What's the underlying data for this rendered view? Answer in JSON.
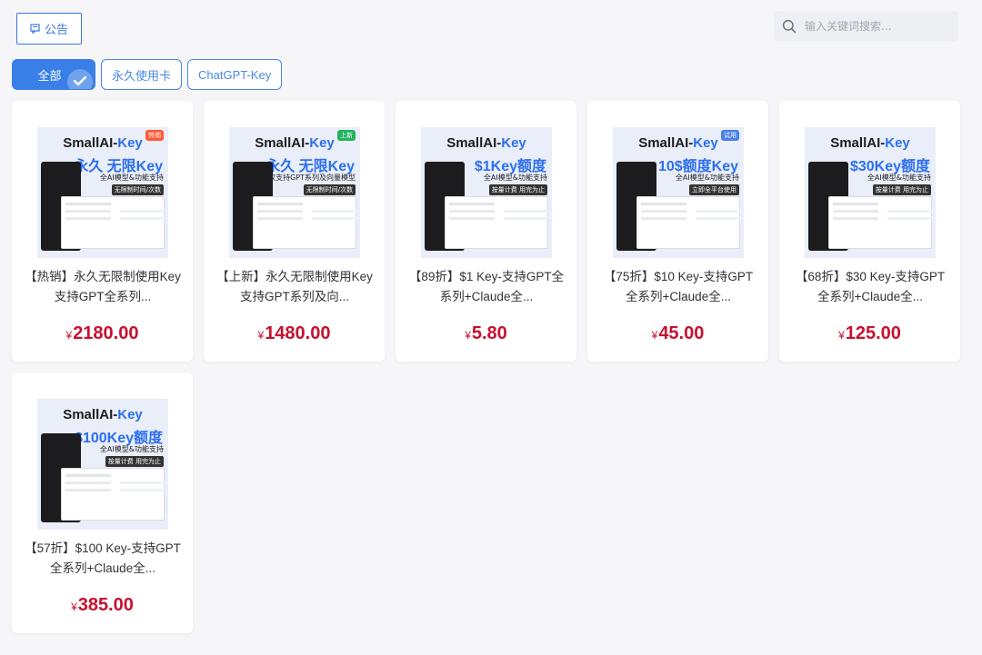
{
  "header": {
    "notice_label": "公告",
    "search_placeholder": "输入关键词搜索..."
  },
  "tabs": [
    {
      "label": "全部",
      "active": true
    },
    {
      "label": "永久使用卡",
      "active": false
    },
    {
      "label": "ChatGPT-Key",
      "active": false
    }
  ],
  "colors": {
    "accent": "#3a7fe8",
    "price": "#c8102e",
    "brand_blue": "#2d6ff0"
  },
  "products": [
    {
      "title": "【热销】永久无限制使用Key 支持GPT全系列...",
      "currency": "¥",
      "price": "2180.00",
      "thumb": {
        "brand_a": "SmallAI-",
        "brand_b": "Key",
        "badge": "热销",
        "big": "永久 无限Key",
        "sub1": "全AI模型&功能支持",
        "sub2": "无限制时间/次数"
      }
    },
    {
      "title": "【上新】永久无限制使用Key 支持GPT系列及向...",
      "currency": "¥",
      "price": "1480.00",
      "thumb": {
        "brand_a": "SmallAI-",
        "brand_b": "Key",
        "badge": "上新",
        "big": "永久 无限Key",
        "sub1": "仅支持GPT系列及向量模型",
        "sub2": "无限制时间/次数"
      }
    },
    {
      "title": "【89折】$1 Key-支持GPT全系列+Claude全...",
      "currency": "¥",
      "price": "5.80",
      "thumb": {
        "brand_a": "SmallAI-",
        "brand_b": "Key",
        "badge": "",
        "big": "$1Key额度",
        "sub1": "全AI模型&功能支持",
        "sub2": "按量计费 用完为止"
      }
    },
    {
      "title": "【75折】$10 Key-支持GPT全系列+Claude全...",
      "currency": "¥",
      "price": "45.00",
      "thumb": {
        "brand_a": "SmallAI-",
        "brand_b": "Key",
        "badge": "试用",
        "big": "10$额度Key",
        "sub1": "全AI模型&功能支持",
        "sub2": "立即全平台使用"
      }
    },
    {
      "title": "【68折】$30 Key-支持GPT全系列+Claude全...",
      "currency": "¥",
      "price": "125.00",
      "thumb": {
        "brand_a": "SmallAI-",
        "brand_b": "Key",
        "badge": "",
        "big": "$30Key额度",
        "sub1": "全AI模型&功能支持",
        "sub2": "按量计费 用完为止"
      }
    },
    {
      "title": "【57折】$100 Key-支持GPT全系列+Claude全...",
      "currency": "¥",
      "price": "385.00",
      "thumb": {
        "brand_a": "SmallAI-",
        "brand_b": "Key",
        "badge": "",
        "big": "$100Key额度",
        "sub1": "全AI模型&功能支持",
        "sub2": "按量计费 用完为止"
      }
    }
  ]
}
